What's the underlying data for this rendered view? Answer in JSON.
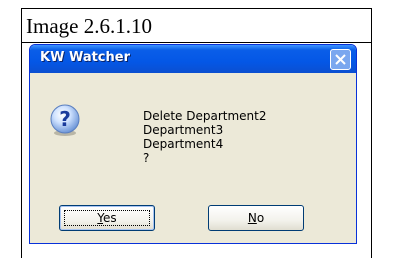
{
  "caption": "Image 2.6.1.10",
  "dialog": {
    "title": "KW Watcher",
    "message_lines": [
      "Delete Department2",
      "Department3",
      "Department4",
      "?"
    ],
    "buttons": {
      "yes_label": "Yes",
      "no_label": "No"
    }
  },
  "colors": {
    "titlebar": "#0457e6",
    "dialog_bg": "#ece9d8",
    "close_button": "#7aa7ef"
  },
  "icons": [
    "question-icon",
    "close-icon"
  ]
}
